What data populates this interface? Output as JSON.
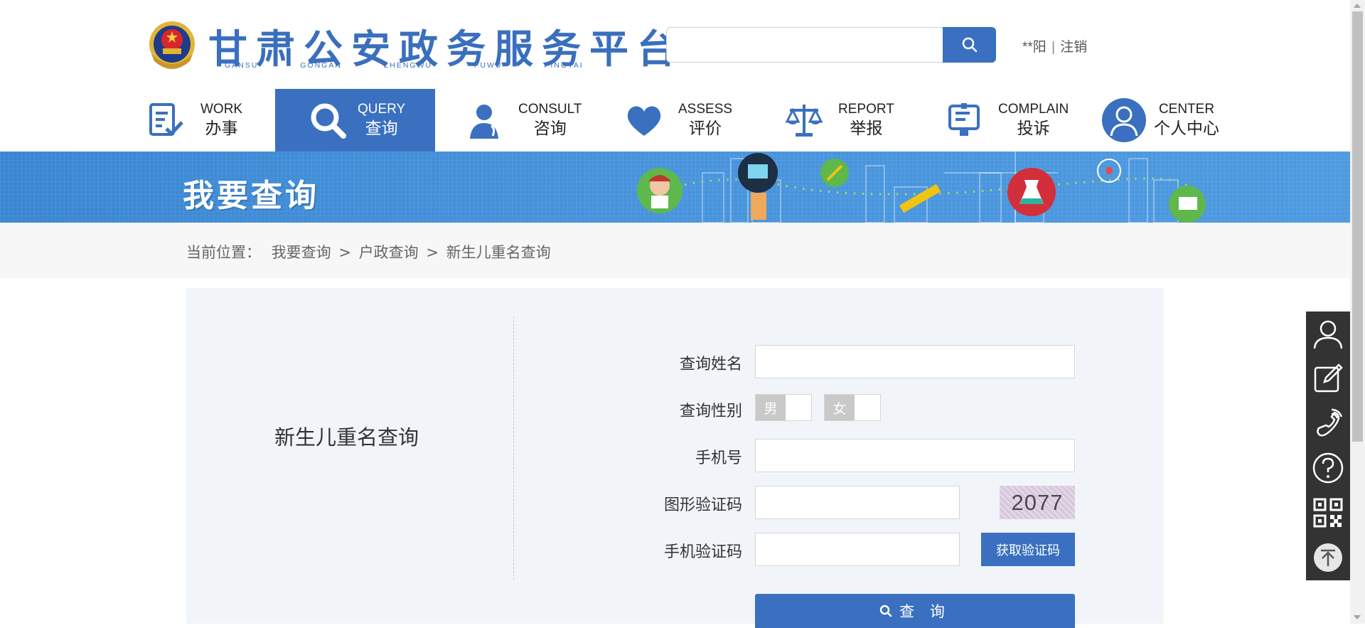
{
  "header": {
    "title_cn": "甘肃公安政务服务平台",
    "title_en": "GANSU GONGAN ZHENGWU FUWU PINGTAI",
    "search": {
      "value": "",
      "placeholder": ""
    },
    "user_name": "**阳",
    "separator": "|",
    "logout_label": "注销"
  },
  "nav": {
    "items": [
      {
        "en": "WORK",
        "cn": "办事",
        "icon": "document-check-icon"
      },
      {
        "en": "QUERY",
        "cn": "查询",
        "icon": "magnifier-icon",
        "active": true
      },
      {
        "en": "CONSULT",
        "cn": "咨询",
        "icon": "operator-icon"
      },
      {
        "en": "ASSESS",
        "cn": "评价",
        "icon": "heart-icon"
      },
      {
        "en": "REPORT",
        "cn": "举报",
        "icon": "scales-icon"
      },
      {
        "en": "COMPLAIN",
        "cn": "投诉",
        "icon": "clipboard-icon"
      },
      {
        "en": "CENTER",
        "cn": "个人中心",
        "icon": "user-icon"
      }
    ]
  },
  "banner": {
    "title": "我要查询"
  },
  "breadcrumb": {
    "prefix": "当前位置：",
    "items": [
      "我要查询",
      "户政查询",
      "新生儿重名查询"
    ],
    "separator": ">"
  },
  "panel": {
    "title": "新生儿重名查询",
    "form": {
      "name_label": "查询姓名",
      "name_value": "",
      "gender_label": "查询性别",
      "gender_male": "男",
      "gender_female": "女",
      "phone_label": "手机号",
      "phone_value": "",
      "captcha_label": "图形验证码",
      "captcha_value": "",
      "captcha_text": "2077",
      "sms_label": "手机验证码",
      "sms_value": "",
      "sms_button": "获取验证码",
      "query_button": "查 询"
    }
  },
  "sidebar": {
    "buttons": [
      "user-icon",
      "edit-icon",
      "phone-icon",
      "help-icon",
      "qrcode-icon",
      "back-to-top-icon"
    ]
  },
  "colors": {
    "primary": "#3a70bf",
    "sidebar": "#333333",
    "panel_bg": "#f1f5fa"
  }
}
